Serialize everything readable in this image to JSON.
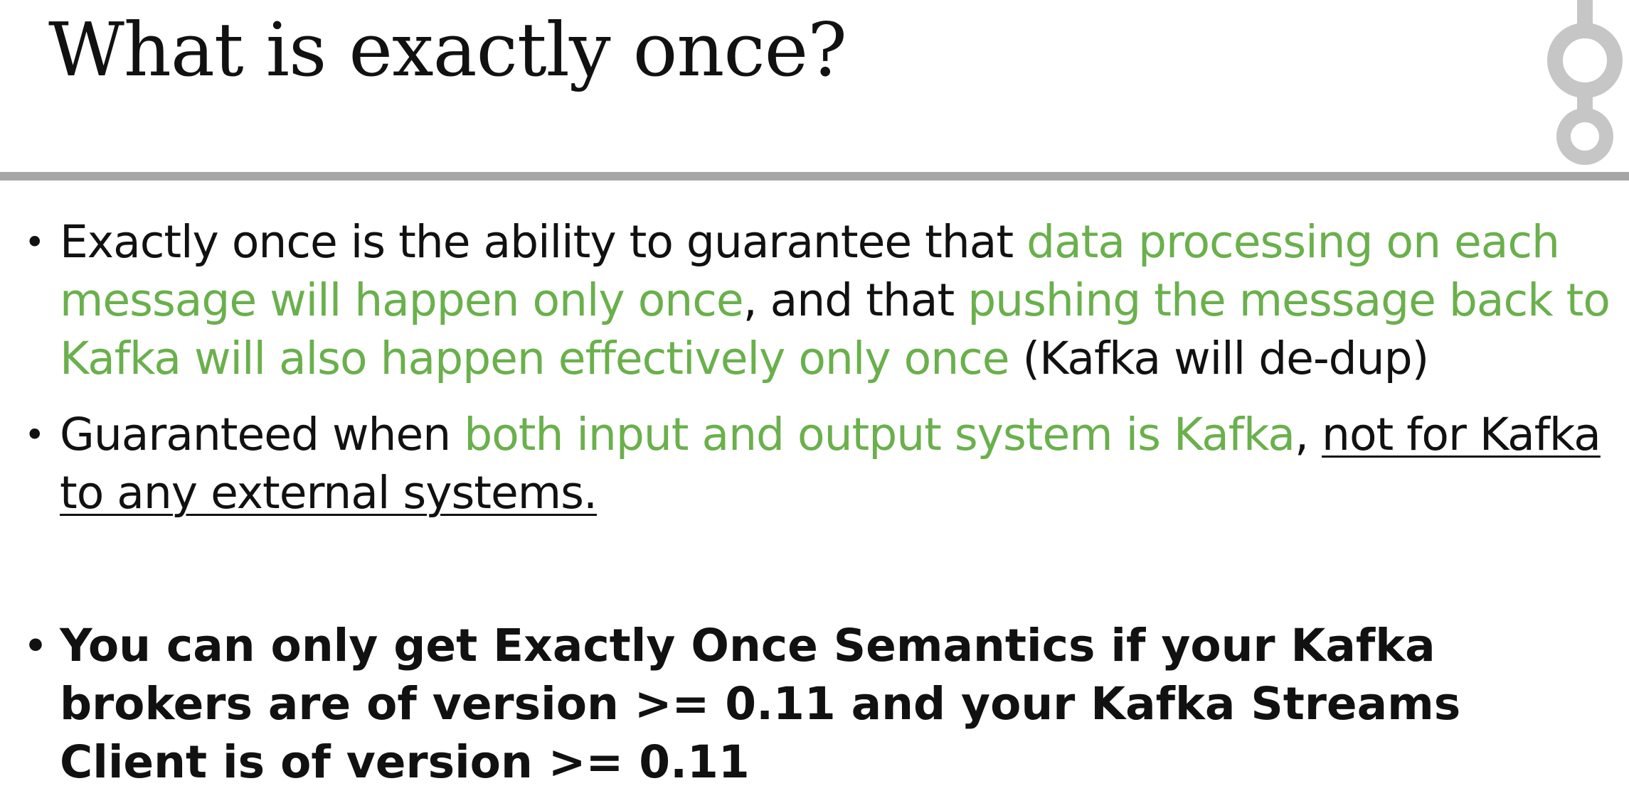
{
  "slide": {
    "title": "What is exactly once?",
    "bullets": [
      {
        "segments": [
          {
            "text": "Exactly once is the ability to guarantee that ",
            "style": "plain"
          },
          {
            "text": "data processing on each message will happen only once",
            "style": "green"
          },
          {
            "text": ", and that ",
            "style": "plain"
          },
          {
            "text": "pushing the message back to Kafka will also happen effectively only once",
            "style": "green"
          },
          {
            "text": " (Kafka will de-dup)",
            "style": "plain"
          }
        ]
      },
      {
        "segments": [
          {
            "text": "Guaranteed when ",
            "style": "plain"
          },
          {
            "text": "both input and output system is Kafka",
            "style": "green"
          },
          {
            "text": ", ",
            "style": "plain"
          },
          {
            "text": "not for Kafka to any external systems.",
            "style": "underline"
          }
        ]
      },
      {
        "segments": [
          {
            "text": "You can only get Exactly Once Semantics if your Kafka brokers are of version >= 0.11 and your Kafka Streams Client is of version >= 0.11",
            "style": "bold"
          }
        ]
      }
    ],
    "bullet_glyph": "•"
  },
  "colors": {
    "accent_green": "#6ab04c",
    "rule_gray": "#a6a6a6",
    "logo_gray": "#c6c6c6",
    "text": "#111111"
  },
  "icons": {
    "logo": "kafka-logo-icon"
  }
}
